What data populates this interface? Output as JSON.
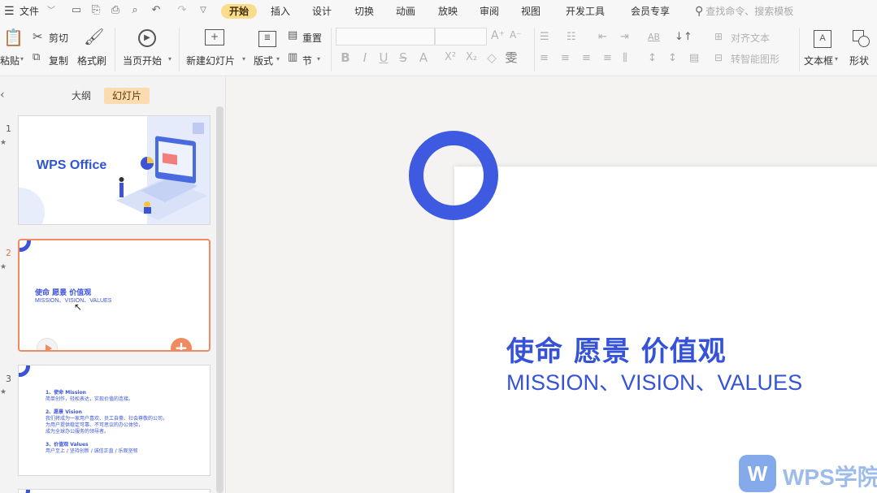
{
  "menu": {
    "file": "文件",
    "tabs": [
      "开始",
      "插入",
      "设计",
      "切换",
      "动画",
      "放映",
      "审阅",
      "视图",
      "开发工具",
      "会员专享"
    ],
    "active_tab": "开始",
    "search_placeholder": "查找命令、搜索模板"
  },
  "ribbon": {
    "paste": "粘贴",
    "cut": "剪切",
    "copy": "复制",
    "format_painter": "格式刷",
    "play_from_current": "当页开始",
    "new_slide": "新建幻灯片",
    "layout": "版式",
    "reset": "重置",
    "section": "节",
    "align_text": "对齐文本",
    "convert_smartart": "转智能图形",
    "textbox": "文本框",
    "shape": "形状"
  },
  "pane": {
    "tabs": [
      "大纲",
      "幻灯片"
    ],
    "active_tab": "幻灯片"
  },
  "slides": [
    {
      "number": "1",
      "title": "WPS Office"
    },
    {
      "number": "2",
      "title": "使命  愿景  价值观",
      "subtitle": "MISSION、VISION、VALUES"
    },
    {
      "number": "3",
      "lines": [
        "1、使命 Mission",
        "简单创作，轻松表达，实现价值的连接。",
        "",
        "2、愿景 Vision",
        "我们将成为一家用户喜欢、员工自豪、社会尊敬的公司，",
        "为用户提供稳定可靠、不可思议的办公体验，",
        "成为全球办公服务的领导者。",
        "",
        "3、价值观 Values",
        "用户至上 / 坚持创新 / 诚信正直 / 乐观坚韧"
      ]
    }
  ],
  "main_slide": {
    "title": "使命  愿景  价值观",
    "subtitle": "MISSION、VISION、VALUES"
  },
  "watermark": {
    "logo_letter": "W",
    "text": "WPS学院"
  },
  "colors": {
    "accent_blue": "#3653d8",
    "active_tab": "#fbdc8a",
    "selection_orange": "#ef8a61"
  }
}
